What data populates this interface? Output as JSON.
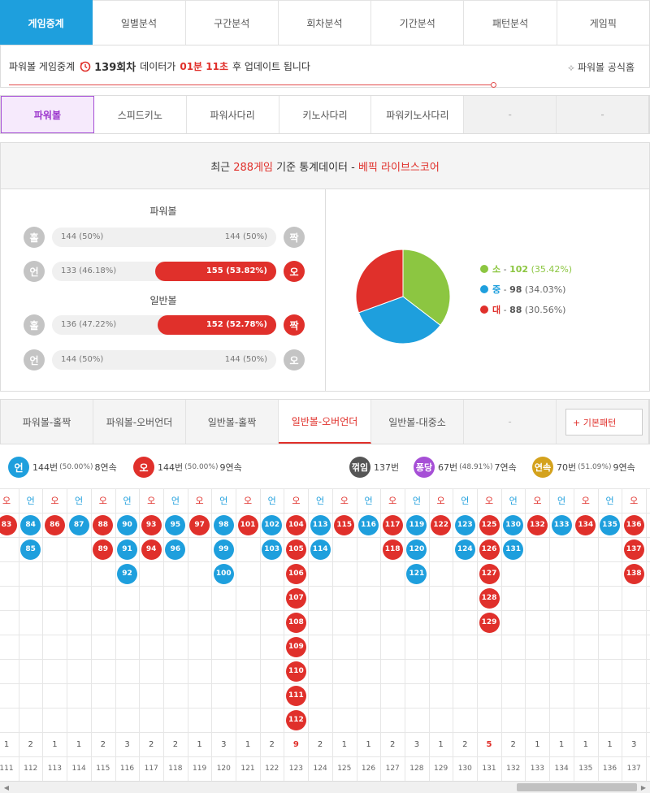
{
  "top_tabs": [
    "게임중계",
    "일별분석",
    "구간분석",
    "회차분석",
    "기간분석",
    "패턴분석",
    "게임픽"
  ],
  "info": {
    "prefix": "파워볼 게임중계",
    "round": "139회차",
    "mid": "데이터가",
    "time": "01분 11초",
    "suffix": "후 업데이트 됩니다",
    "official": "파워볼 공식홈"
  },
  "game_tabs": [
    "파워볼",
    "스피드키노",
    "파워사다리",
    "키노사다리",
    "파워키노사다리",
    "-",
    "-"
  ],
  "stats": {
    "title_pre": "최근",
    "title_count": "288게임",
    "title_mid": "기준 통계데이터 -",
    "title_brand": "베픽 라이브스코어",
    "powerball_label": "파워볼",
    "normal_label": "일반볼",
    "rows": [
      {
        "left": "홀",
        "right": "짝",
        "lval": "144 (50%)",
        "rval": "144 (50%)",
        "fill": null,
        "fill_pct": 0,
        "right_red": false
      },
      {
        "left": "언",
        "right": "오",
        "lval": "133 (46.18%)",
        "rval": "155 (53.82%)",
        "fill": "right",
        "fill_pct": 53.82,
        "right_red": true
      },
      {
        "left": "홀",
        "right": "짝",
        "lval": "136 (47.22%)",
        "rval": "152 (52.78%)",
        "fill": "right",
        "fill_pct": 52.78,
        "right_red": true
      },
      {
        "left": "언",
        "right": "오",
        "lval": "144 (50%)",
        "rval": "144 (50%)",
        "fill": null,
        "fill_pct": 0,
        "right_red": false
      }
    ],
    "pie": [
      {
        "label": "소",
        "count": "102",
        "pct": "(35.42%)",
        "value": 35.42,
        "color": "#8cc641"
      },
      {
        "label": "중",
        "count": "98",
        "pct": "(34.03%)",
        "value": 34.03,
        "color": "#1e9fdd"
      },
      {
        "label": "대",
        "count": "88",
        "pct": "(30.56%)",
        "value": 30.56,
        "color": "#e0302b"
      }
    ]
  },
  "sub_tabs": [
    "파워볼-홀짝",
    "파워볼-오버언더",
    "일반볼-홀짝",
    "일반볼-오버언더",
    "일반볼-대중소",
    "-"
  ],
  "basic_pattern": "+ 기본패턴",
  "summary": {
    "under": {
      "badge": "언",
      "count": "144번",
      "pct": "(50.00%)",
      "streak": "8연속",
      "color": "#1e9fdd"
    },
    "over": {
      "badge": "오",
      "count": "144번",
      "pct": "(50.00%)",
      "streak": "9연속",
      "color": "#e0302b"
    },
    "break": {
      "badge": "꺾임",
      "count": "137번",
      "color": "#555555"
    },
    "pong": {
      "badge": "퐁당",
      "count": "67번",
      "pct": "(48.91%)",
      "streak": "7연속",
      "color": "#a64fd6"
    },
    "cont": {
      "badge": "연속",
      "count": "70번",
      "pct": "(51.09%)",
      "streak": "9연속",
      "color": "#d4a21d"
    }
  },
  "grid": {
    "labels": {
      "o": "오",
      "u": "언"
    },
    "columns": [
      {
        "t": "o",
        "balls": [
          "83"
        ],
        "round": "111"
      },
      {
        "t": "u",
        "balls": [
          "84",
          "85"
        ],
        "round": "112"
      },
      {
        "t": "o",
        "balls": [
          "86"
        ],
        "round": "113"
      },
      {
        "t": "u",
        "balls": [
          "87"
        ],
        "round": "114"
      },
      {
        "t": "o",
        "balls": [
          "88",
          "89"
        ],
        "round": "115"
      },
      {
        "t": "u",
        "balls": [
          "90",
          "91",
          "92"
        ],
        "round": "116"
      },
      {
        "t": "o",
        "balls": [
          "93",
          "94"
        ],
        "round": "117"
      },
      {
        "t": "u",
        "balls": [
          "95",
          "96"
        ],
        "round": "118"
      },
      {
        "t": "o",
        "balls": [
          "97"
        ],
        "round": "119"
      },
      {
        "t": "u",
        "balls": [
          "98",
          "99",
          "100"
        ],
        "round": "120"
      },
      {
        "t": "o",
        "balls": [
          "101"
        ],
        "round": "121"
      },
      {
        "t": "u",
        "balls": [
          "102",
          "103"
        ],
        "round": "122"
      },
      {
        "t": "o",
        "balls": [
          "104",
          "105",
          "106",
          "107",
          "108",
          "109",
          "110",
          "111",
          "112"
        ],
        "round": "123"
      },
      {
        "t": "u",
        "balls": [
          "113",
          "114"
        ],
        "round": "124"
      },
      {
        "t": "o",
        "balls": [
          "115"
        ],
        "round": "125"
      },
      {
        "t": "u",
        "balls": [
          "116"
        ],
        "round": "126"
      },
      {
        "t": "o",
        "balls": [
          "117",
          "118"
        ],
        "round": "127"
      },
      {
        "t": "u",
        "balls": [
          "119",
          "120",
          "121"
        ],
        "round": "128"
      },
      {
        "t": "o",
        "balls": [
          "122"
        ],
        "round": "129"
      },
      {
        "t": "u",
        "balls": [
          "123",
          "124"
        ],
        "round": "130"
      },
      {
        "t": "o",
        "balls": [
          "125",
          "126",
          "127",
          "128",
          "129"
        ],
        "round": "131"
      },
      {
        "t": "u",
        "balls": [
          "130",
          "131"
        ],
        "round": "132"
      },
      {
        "t": "o",
        "balls": [
          "132"
        ],
        "round": "133"
      },
      {
        "t": "u",
        "balls": [
          "133"
        ],
        "round": "134"
      },
      {
        "t": "o",
        "balls": [
          "134"
        ],
        "round": "135"
      },
      {
        "t": "u",
        "balls": [
          "135"
        ],
        "round": "136"
      },
      {
        "t": "o",
        "balls": [
          "136",
          "137",
          "138"
        ],
        "round": "137"
      }
    ],
    "counts": [
      "1",
      "2",
      "1",
      "1",
      "2",
      "3",
      "2",
      "2",
      "1",
      "3",
      "1",
      "2",
      "9",
      "2",
      "1",
      "1",
      "2",
      "3",
      "1",
      "2",
      "5",
      "2",
      "1",
      "1",
      "1",
      "1",
      "3"
    ],
    "highlight_counts": [
      "9",
      "5"
    ]
  },
  "scroll": {
    "left": "◀",
    "right": "▶"
  }
}
